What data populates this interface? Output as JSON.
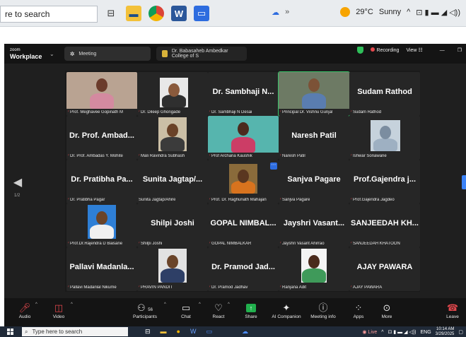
{
  "top_taskbar": {
    "search_text": "re to search",
    "weather_temp": "29°C",
    "weather_desc": "Sunny"
  },
  "zoom": {
    "brand_small": "zoom",
    "brand_big": "Workplace",
    "tab_meeting": "Meeting",
    "tab_college": "Dr. Babasaheb Ambedkar College of S",
    "recording": "Recording",
    "view": "View",
    "page_indicator": "1/2"
  },
  "tiles": [
    {
      "big": "",
      "label": "Prof. Meghavee Gopinath M",
      "video": "woman1"
    },
    {
      "big": "",
      "label": "Dr. Dileep Ghongade",
      "video": "man1"
    },
    {
      "big": "Dr. Sambhaji N...",
      "label": "Dr. Sambhaji N Desai"
    },
    {
      "big": "",
      "label": "Principal Dr. Vishnu Gunjal",
      "video": "man2",
      "active": true
    },
    {
      "big": "Sudam Rathod",
      "label": "Sudam Rathod"
    },
    {
      "big": "Dr. Prof. Ambad...",
      "label": "Dr. Prof. Ambadas Y. Mohite"
    },
    {
      "big": "",
      "label": "Mali Ravindra Subhash",
      "video": "man3"
    },
    {
      "big": "",
      "label": "Prof Archana Kaushik",
      "video": "woman2"
    },
    {
      "big": "Naresh Patil",
      "label": "Naresh Patil"
    },
    {
      "big": "",
      "label": "Ishwar Sonawane",
      "video": "lake"
    },
    {
      "big": "Dr. Pratibha Pa...",
      "label": "Dr. Pratibha Pagar"
    },
    {
      "big": "Sunita Jagtap/...",
      "label": "Sunita Jagtap/Ahire"
    },
    {
      "big": "",
      "label": "Prof. Dr. Raghunath Mahajan",
      "video": "man4"
    },
    {
      "big": "Sanjva Pagare",
      "label": "Sanjva Pagare"
    },
    {
      "big": "Prof.Gajendra j...",
      "label": "Prof.Gajendra Jagdeo"
    },
    {
      "big": "",
      "label": "Prof.Dr.Rajendra D Baisane",
      "video": "man5"
    },
    {
      "big": "Shilpi Joshi",
      "label": "Shilpi Joshi"
    },
    {
      "big": "GOPAL NIMBAL...",
      "label": "GOPAL NIMBALKAR"
    },
    {
      "big": "Jayshri Vasant...",
      "label": "Jayshri Vasant Ahirrao"
    },
    {
      "big": "SANJEEDAH KH...",
      "label": "SANJEEDAH KHATOON"
    },
    {
      "big": "Pallavi Madanla...",
      "label": "Pallavi Madanlal Nikume"
    },
    {
      "big": "",
      "label": "PRAVIN PANDIT",
      "video": "man6"
    },
    {
      "big": "Dr. Pramod Jad...",
      "label": "Dr. Pramod Jadhav"
    },
    {
      "big": "",
      "label": "Ranjana Adit",
      "video": "woman3"
    },
    {
      "big": "AJAY PAWARA",
      "label": "AJAY PAWARA"
    }
  ],
  "toolbar": {
    "audio": "Audio",
    "video": "Video",
    "participants": "Participants",
    "participants_count": "56",
    "chat": "Chat",
    "react": "React",
    "share": "Share",
    "ai": "AI Companion",
    "info": "Meeting info",
    "apps": "Apps",
    "more": "More",
    "leave": "Leave"
  },
  "bottom_taskbar": {
    "search_text": "Type here to search",
    "live": "Live",
    "lang": "ENG",
    "time": "10:14 AM",
    "date": "3/29/2025"
  }
}
